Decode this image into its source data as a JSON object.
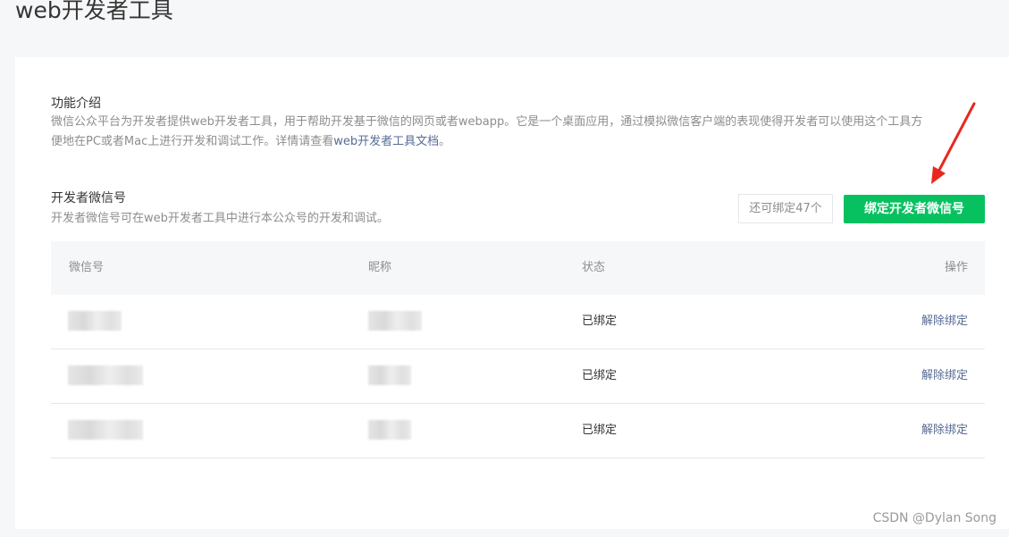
{
  "page": {
    "title": "web开发者工具"
  },
  "intro": {
    "title": "功能介绍",
    "desc_line1": "微信公众平台为开发者提供web开发者工具，用于帮助开发基于微信的网页或者webapp。它是一个桌面应用，通过模拟微信客户端的表现使得开发者可以使用这个工具方",
    "desc_line2_pre": "便地在PC或者Mac上进行开发和调试工作。详情请查看",
    "doc_link": "web开发者工具文档",
    "desc_line2_post": "。"
  },
  "devs": {
    "title": "开发者微信号",
    "desc": "开发者微信号可在web开发者工具中进行本公众号的开发和调试。",
    "remaining": "还可绑定47个",
    "bind_button": "绑定开发者微信号"
  },
  "table": {
    "headers": {
      "wechat_id": "微信号",
      "nickname": "昵称",
      "status": "状态",
      "action": "操作"
    },
    "rows": [
      {
        "status": "已绑定",
        "action": "解除绑定"
      },
      {
        "status": "已绑定",
        "action": "解除绑定"
      },
      {
        "status": "已绑定",
        "action": "解除绑定"
      }
    ]
  },
  "watermark": "CSDN @Dylan  Song",
  "colors": {
    "accent_green": "#07c160",
    "link_blue": "#576b95",
    "annotation_red": "#e8281e"
  }
}
